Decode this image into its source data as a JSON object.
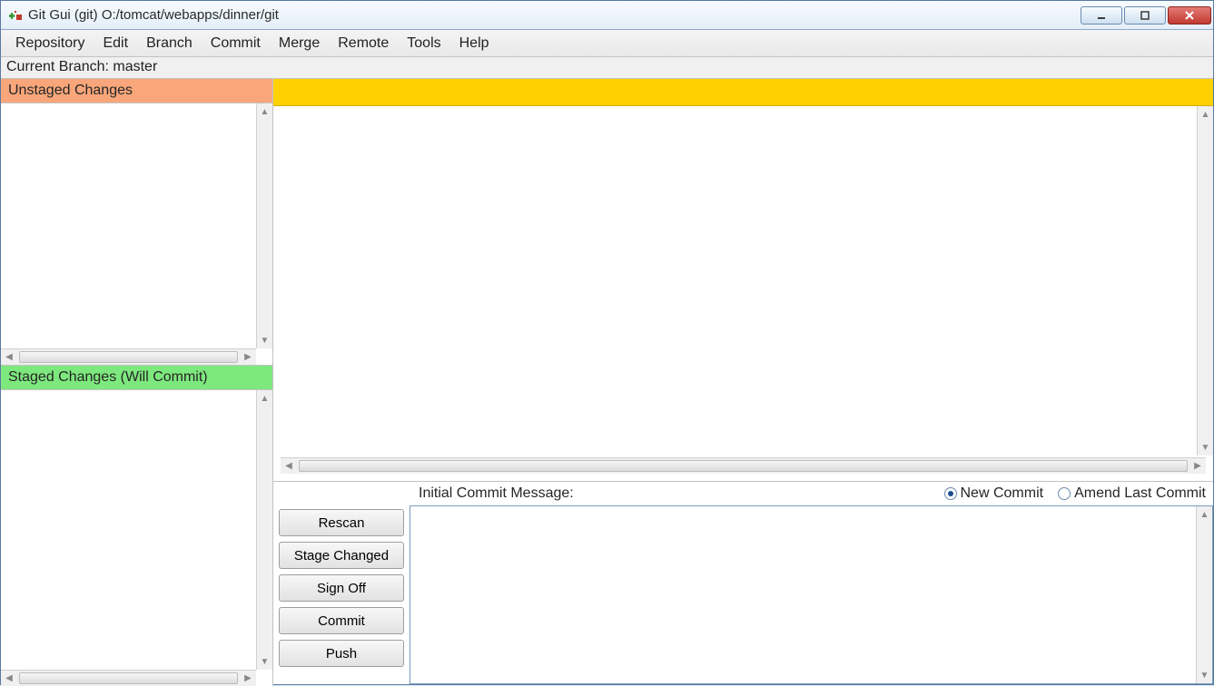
{
  "window": {
    "title": "Git Gui (git) O:/tomcat/webapps/dinner/git"
  },
  "menu": {
    "items": [
      "Repository",
      "Edit",
      "Branch",
      "Commit",
      "Merge",
      "Remote",
      "Tools",
      "Help"
    ]
  },
  "branchbar": {
    "text": "Current Branch: master"
  },
  "panes": {
    "unstaged_label": "Unstaged Changes",
    "staged_label": "Staged Changes (Will Commit)"
  },
  "commit": {
    "message_label": "Initial Commit Message:",
    "radio_new": "New Commit",
    "radio_amend": "Amend Last Commit",
    "radio_selected": "new",
    "buttons": {
      "rescan": "Rescan",
      "stage_changed": "Stage Changed",
      "sign_off": "Sign Off",
      "commit": "Commit",
      "push": "Push"
    },
    "message_value": ""
  }
}
